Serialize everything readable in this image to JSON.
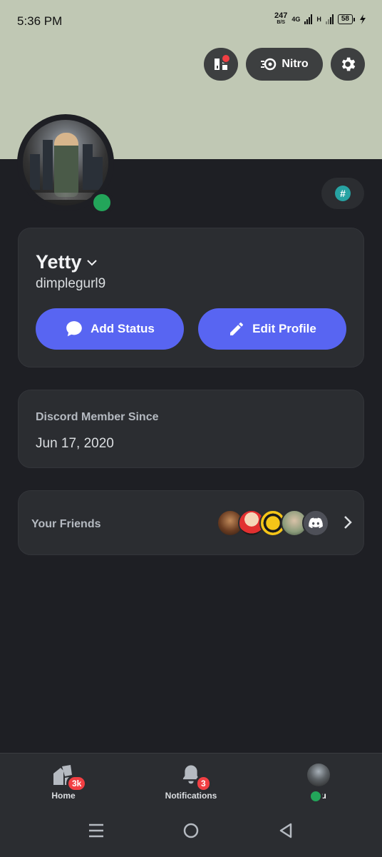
{
  "status_bar": {
    "time": "5:36 PM",
    "net_speed": "247",
    "net_unit": "B/S",
    "network_label": "4G",
    "network2_label": "H",
    "battery": "58"
  },
  "header": {
    "shop_icon": "shop-icon",
    "nitro_label": "Nitro",
    "settings_icon": "gear-icon",
    "banner_color": "#c0c8b4"
  },
  "profile": {
    "display_name": "Yetty",
    "username": "dimplegurl9",
    "status_color": "#23a55a",
    "add_status_label": "Add Status",
    "edit_profile_label": "Edit Profile",
    "accent": "#5865f2"
  },
  "member_since": {
    "title": "Discord Member Since",
    "date": "Jun 17, 2020"
  },
  "friends": {
    "title": "Your Friends"
  },
  "bottom_nav": {
    "home_label": "Home",
    "home_badge": "3k",
    "notifications_label": "Notifications",
    "notifications_badge": "3",
    "you_label": "You"
  }
}
